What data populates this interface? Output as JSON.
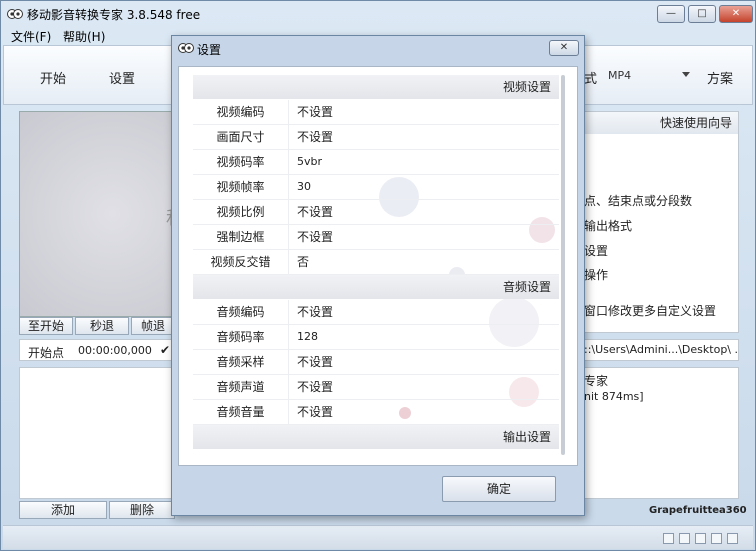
{
  "app": {
    "title": "移动影音转换专家 3.8.548 free",
    "window_controls": {
      "minimize": "—",
      "maximize": "□",
      "close": "✕"
    }
  },
  "menu": [
    {
      "label": "文件(F)"
    },
    {
      "label": "帮助(H)"
    }
  ],
  "toolbar": {
    "start_label": "开始",
    "settings_label": "设置",
    "format_label": "式",
    "format_value": "MP4",
    "scheme_label": "方案"
  },
  "preview": {
    "partial_text": "和"
  },
  "controls": {
    "to_start": "至开始",
    "back_seconds": "秒退",
    "back_frame": "帧退"
  },
  "startpoint": {
    "label": "开始点",
    "time": "00:00:00,000",
    "check": "✔"
  },
  "file_buttons": {
    "add": "添加",
    "delete": "删除"
  },
  "guide": {
    "header": "快速使用向导",
    "lines": [
      "点、结束点或分段数",
      "输出格式",
      "设置",
      "操作",
      "窗口修改更多自定义设置"
    ]
  },
  "output_path": "::\\Users\\Admini...\\Desktop\\  ...",
  "log": {
    "line1": "专家",
    "line2": "nit 874ms]"
  },
  "brand": "Grapefruittea360",
  "dialog": {
    "title": "设置",
    "close": "✕",
    "ok_label": "确定",
    "sections": {
      "video": "视频设置",
      "audio": "音频设置",
      "output": "输出设置"
    },
    "video_rows": [
      {
        "label": "视频编码",
        "value": "不设置"
      },
      {
        "label": "画面尺寸",
        "value": "不设置"
      },
      {
        "label": "视频码率",
        "value": "5vbr"
      },
      {
        "label": "视频帧率",
        "value": "30"
      },
      {
        "label": "视频比例",
        "value": "不设置"
      },
      {
        "label": "强制边框",
        "value": "不设置"
      },
      {
        "label": "视频反交错",
        "value": "否"
      }
    ],
    "audio_rows": [
      {
        "label": "音频编码",
        "value": "不设置"
      },
      {
        "label": "音频码率",
        "value": "128"
      },
      {
        "label": "音频采样",
        "value": "不设置"
      },
      {
        "label": "音频声道",
        "value": "不设置"
      },
      {
        "label": "音频音量",
        "value": "不设置"
      }
    ]
  }
}
